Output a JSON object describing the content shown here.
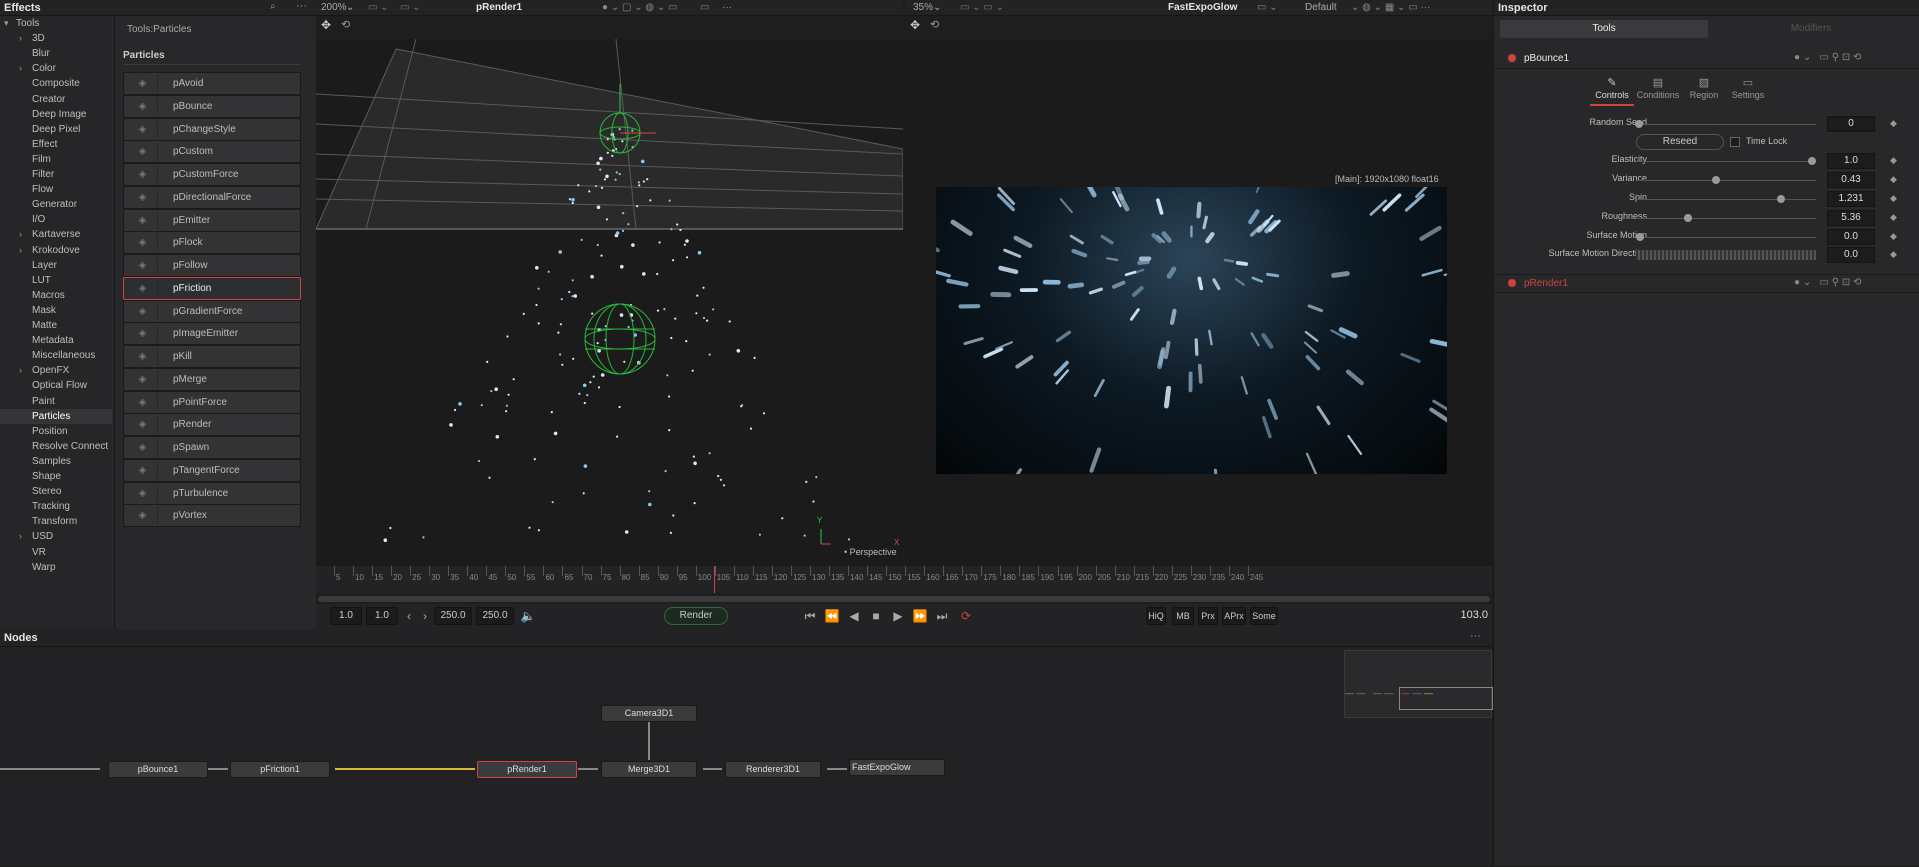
{
  "effects": {
    "title": "Effects",
    "breadcrumb": "Tools:Particles",
    "category": "Particles",
    "tree": [
      {
        "label": "Tools",
        "expand": "▾",
        "indent": 0
      },
      {
        "label": "3D",
        "expand": "›",
        "indent": 1
      },
      {
        "label": "Blur",
        "expand": "",
        "indent": 1
      },
      {
        "label": "Color",
        "expand": "›",
        "indent": 1
      },
      {
        "label": "Composite",
        "expand": "",
        "indent": 1
      },
      {
        "label": "Creator",
        "expand": "",
        "indent": 1
      },
      {
        "label": "Deep Image",
        "expand": "",
        "indent": 1
      },
      {
        "label": "Deep Pixel",
        "expand": "",
        "indent": 1
      },
      {
        "label": "Effect",
        "expand": "",
        "indent": 1
      },
      {
        "label": "Film",
        "expand": "",
        "indent": 1
      },
      {
        "label": "Filter",
        "expand": "",
        "indent": 1
      },
      {
        "label": "Flow",
        "expand": "",
        "indent": 1
      },
      {
        "label": "Generator",
        "expand": "",
        "indent": 1
      },
      {
        "label": "I/O",
        "expand": "",
        "indent": 1
      },
      {
        "label": "Kartaverse",
        "expand": "›",
        "indent": 1
      },
      {
        "label": "Krokodove",
        "expand": "›",
        "indent": 1
      },
      {
        "label": "Layer",
        "expand": "",
        "indent": 1
      },
      {
        "label": "LUT",
        "expand": "",
        "indent": 1
      },
      {
        "label": "Macros",
        "expand": "",
        "indent": 1
      },
      {
        "label": "Mask",
        "expand": "",
        "indent": 1
      },
      {
        "label": "Matte",
        "expand": "",
        "indent": 1
      },
      {
        "label": "Metadata",
        "expand": "",
        "indent": 1
      },
      {
        "label": "Miscellaneous",
        "expand": "",
        "indent": 1
      },
      {
        "label": "OpenFX",
        "expand": "›",
        "indent": 1
      },
      {
        "label": "Optical Flow",
        "expand": "",
        "indent": 1
      },
      {
        "label": "Paint",
        "expand": "",
        "indent": 1
      },
      {
        "label": "Particles",
        "expand": "",
        "indent": 1,
        "selected": true
      },
      {
        "label": "Position",
        "expand": "",
        "indent": 1
      },
      {
        "label": "Resolve Connect",
        "expand": "",
        "indent": 1
      },
      {
        "label": "Samples",
        "expand": "",
        "indent": 1
      },
      {
        "label": "Shape",
        "expand": "",
        "indent": 1
      },
      {
        "label": "Stereo",
        "expand": "",
        "indent": 1
      },
      {
        "label": "Tracking",
        "expand": "",
        "indent": 1
      },
      {
        "label": "Transform",
        "expand": "",
        "indent": 1
      },
      {
        "label": "USD",
        "expand": "›",
        "indent": 1
      },
      {
        "label": "VR",
        "expand": "",
        "indent": 1
      },
      {
        "label": "Warp",
        "expand": "",
        "indent": 1
      }
    ],
    "tools": [
      {
        "label": "pAvoid",
        "icon": "avoid-icon"
      },
      {
        "label": "pBounce",
        "icon": "bounce-icon"
      },
      {
        "label": "pChangeStyle",
        "icon": "change-style-icon"
      },
      {
        "label": "pCustom",
        "icon": "custom-icon"
      },
      {
        "label": "pCustomForce",
        "icon": "custom-force-icon"
      },
      {
        "label": "pDirectionalForce",
        "icon": "directional-force-icon"
      },
      {
        "label": "pEmitter",
        "icon": "emitter-icon"
      },
      {
        "label": "pFlock",
        "icon": "flock-icon"
      },
      {
        "label": "pFollow",
        "icon": "follow-icon"
      },
      {
        "label": "pFriction",
        "icon": "friction-icon",
        "selected": true
      },
      {
        "label": "pGradientForce",
        "icon": "gradient-force-icon"
      },
      {
        "label": "pImageEmitter",
        "icon": "image-emitter-icon"
      },
      {
        "label": "pKill",
        "icon": "kill-icon"
      },
      {
        "label": "pMerge",
        "icon": "merge-icon"
      },
      {
        "label": "pPointForce",
        "icon": "point-force-icon"
      },
      {
        "label": "pRender",
        "icon": "render-icon"
      },
      {
        "label": "pSpawn",
        "icon": "spawn-icon"
      },
      {
        "label": "pTangentForce",
        "icon": "tangent-force-icon"
      },
      {
        "label": "pTurbulence",
        "icon": "turbulence-icon"
      },
      {
        "label": "pVortex",
        "icon": "vortex-icon"
      }
    ]
  },
  "viewer_left": {
    "zoom": "200%",
    "title": "pRender1",
    "label": "Perspective",
    "axis_y": "Y",
    "axis_x": "X"
  },
  "viewer_right": {
    "zoom": "35%",
    "title": "FastExpoGlow",
    "lut": "Default",
    "info": "[Main]: 1920x1080 float16"
  },
  "timeline": {
    "ticks": [
      "5",
      "10",
      "15",
      "20",
      "25",
      "30",
      "35",
      "40",
      "45",
      "50",
      "55",
      "60",
      "65",
      "70",
      "75",
      "80",
      "85",
      "90",
      "95",
      "100",
      "105",
      "110",
      "115",
      "120",
      "125",
      "130",
      "135",
      "140",
      "145",
      "150",
      "155",
      "160",
      "165",
      "170",
      "175",
      "180",
      "185",
      "190",
      "195",
      "200",
      "205",
      "210",
      "215",
      "220",
      "225",
      "230",
      "235",
      "240",
      "245"
    ],
    "start": "1.0",
    "render_start": "1.0",
    "render_end": "250.0",
    "end": "250.0",
    "render_label": "Render",
    "current_frame": "103.0",
    "toggles": [
      "HiQ",
      "MB",
      "Prx",
      "APrx",
      "Some"
    ]
  },
  "inspector": {
    "title": "Inspector",
    "tabs": [
      "Tools",
      "Modifiers"
    ],
    "node1": "pBounce1",
    "node2": "pRender1",
    "subtabs": [
      "Controls",
      "Conditions",
      "Region",
      "Settings"
    ],
    "random_seed_label": "Random Seed",
    "random_seed_value": "0",
    "reseed_label": "Reseed",
    "time_lock_label": "Time Lock",
    "params": [
      {
        "label": "Elasticity",
        "value": "1.0",
        "pos": 0.98
      },
      {
        "label": "Variance",
        "value": "0.43",
        "pos": 0.43
      },
      {
        "label": "Spin",
        "value": "1.231",
        "pos": 0.8
      },
      {
        "label": "Roughness",
        "value": "5.36",
        "pos": 0.27
      },
      {
        "label": "Surface Motion",
        "value": "0.0",
        "pos": 0.0
      }
    ],
    "surface_dir_label": "Surface Motion Direction",
    "surface_dir_value": "0.0"
  },
  "nodes": {
    "title": "Nodes",
    "list": [
      "pBounce1",
      "pFriction1",
      "pRender1",
      "Camera3D1",
      "Merge3D1",
      "Renderer3D1",
      "FastExpoGlow"
    ]
  }
}
